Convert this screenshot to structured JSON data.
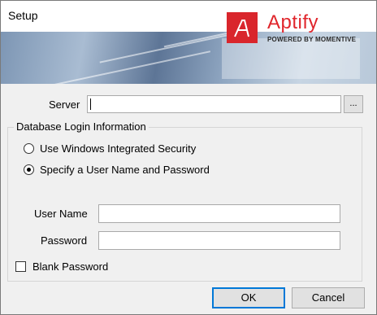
{
  "window": {
    "title": "Setup"
  },
  "banner": {
    "logo_name": "Aptify",
    "logo_tagline": "POWERED BY MOMENTIVE",
    "brand_color": "#e0262c"
  },
  "server": {
    "label": "Server",
    "value": "",
    "browse_label": "..."
  },
  "login_group": {
    "legend": "Database Login Information",
    "options": [
      {
        "label": "Use Windows Integrated Security",
        "selected": false
      },
      {
        "label": "Specify a User Name and Password",
        "selected": true
      }
    ],
    "username_label": "User Name",
    "username_value": "",
    "password_label": "Password",
    "password_value": "",
    "blank_password_label": "Blank Password",
    "blank_password_checked": false
  },
  "buttons": {
    "ok": "OK",
    "cancel": "Cancel"
  }
}
